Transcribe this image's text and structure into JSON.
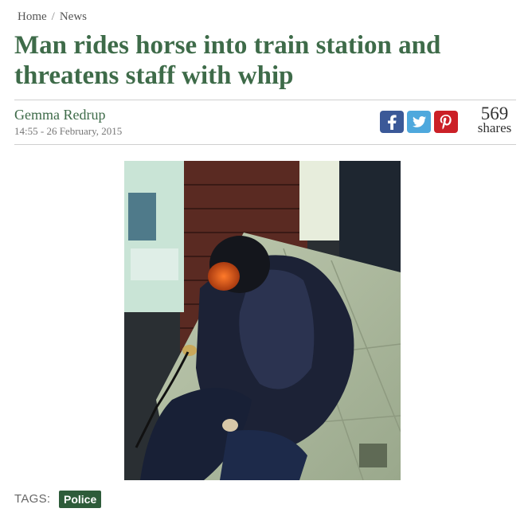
{
  "breadcrumb": {
    "home": "Home",
    "separator": "/",
    "current": "News"
  },
  "article": {
    "title": "Man rides horse into train station and threatens staff with whip",
    "author": "Gemma Redrup",
    "date": "14:55 - 26 February, 2015"
  },
  "share": {
    "buttons": [
      {
        "name": "facebook",
        "icon": "facebook-icon",
        "color": "#3b5998"
      },
      {
        "name": "twitter",
        "icon": "twitter-icon",
        "color": "#4ea8dd"
      },
      {
        "name": "pinterest",
        "icon": "pinterest-icon",
        "color": "#cb2027"
      }
    ],
    "count": "569",
    "count_label": "shares"
  },
  "tags": {
    "label": "TAGS:",
    "items": [
      "Police"
    ]
  },
  "colors": {
    "title": "#3e6b49",
    "tag_bg": "#2e5c3a"
  }
}
